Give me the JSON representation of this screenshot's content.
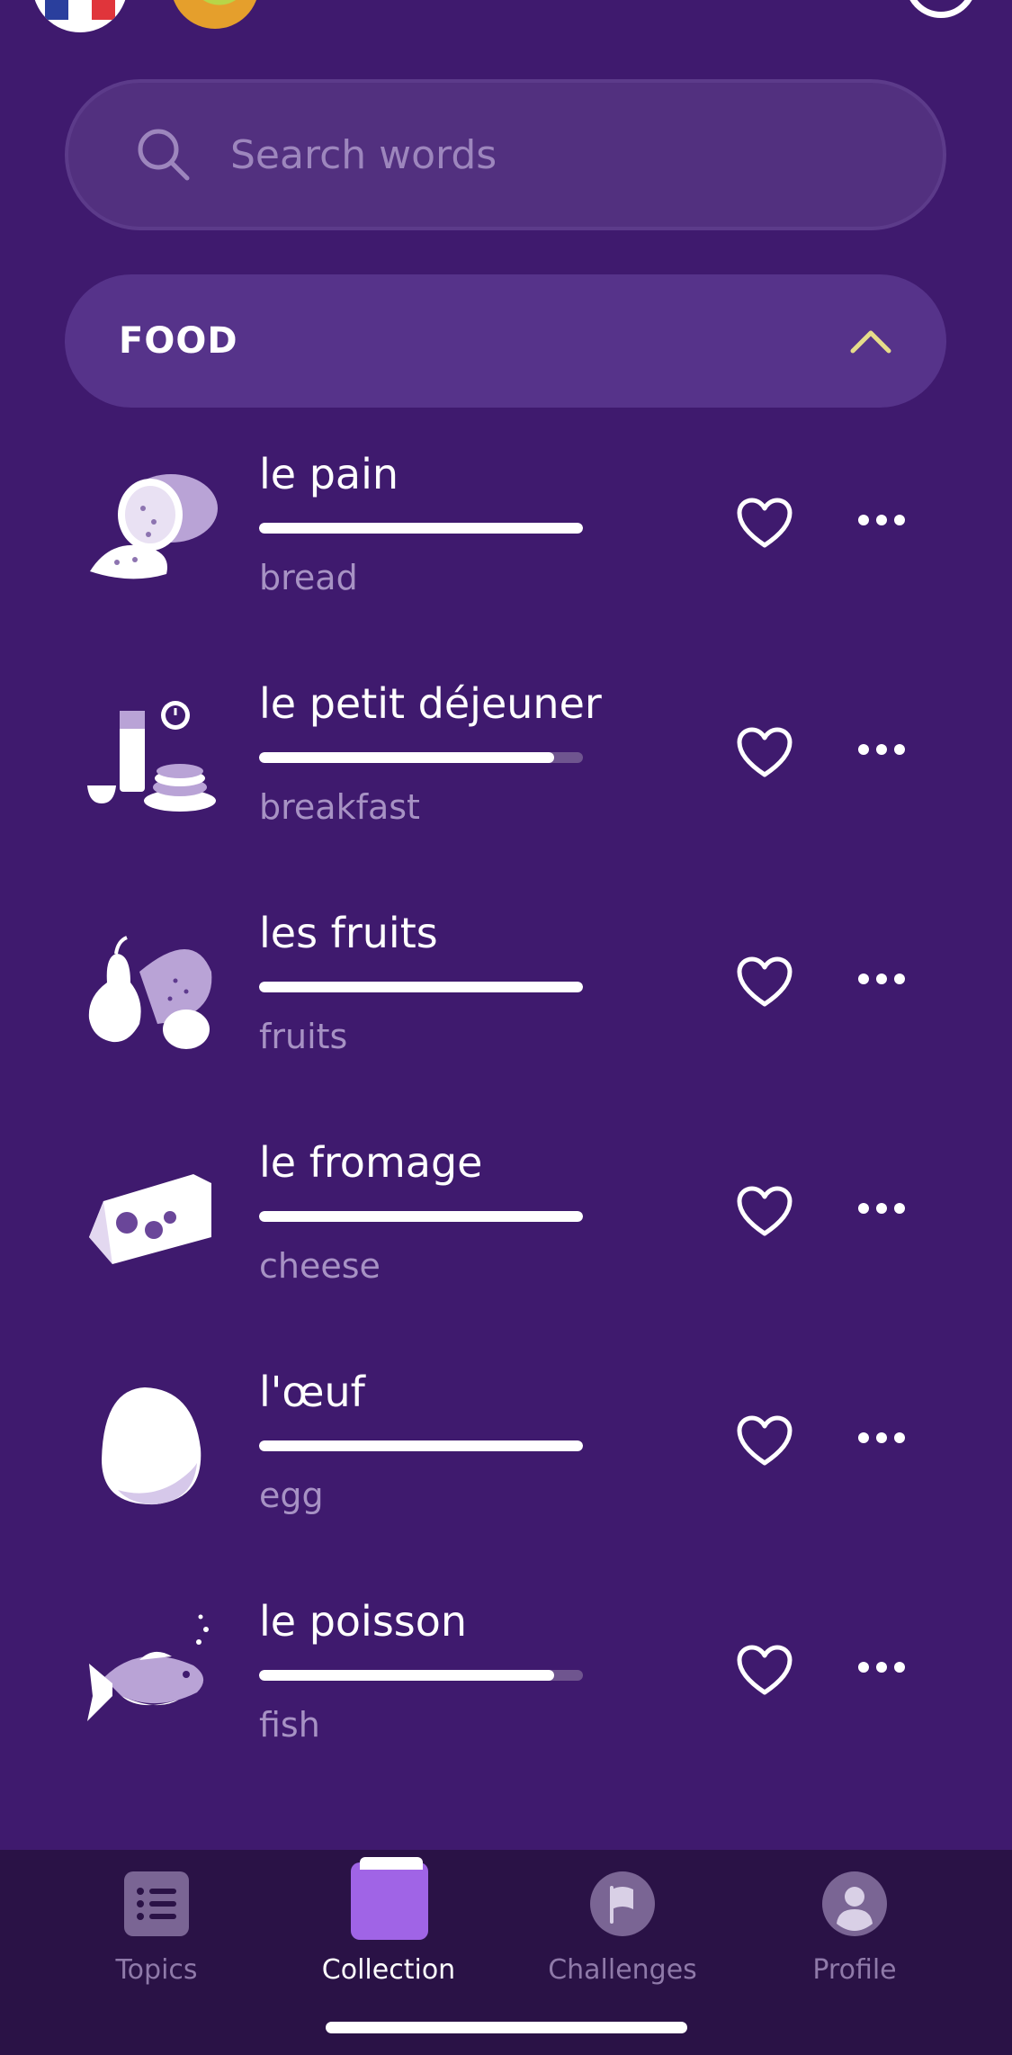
{
  "search": {
    "placeholder": "Search words"
  },
  "section": {
    "title": "FOOD",
    "chevron": "chevron-up-icon",
    "chevron_color": "#e6dc8a"
  },
  "items": [
    {
      "word": "le pain",
      "translation": "bread",
      "progress": 1.0,
      "icon": "bread-icon"
    },
    {
      "word": "le petit déjeuner",
      "translation": "breakfast",
      "progress": 0.91,
      "icon": "breakfast-icon"
    },
    {
      "word": "les fruits",
      "translation": "fruits",
      "progress": 1.0,
      "icon": "fruits-icon"
    },
    {
      "word": "le fromage",
      "translation": "cheese",
      "progress": 1.0,
      "icon": "cheese-icon"
    },
    {
      "word": "l'œuf",
      "translation": "egg",
      "progress": 1.0,
      "icon": "egg-icon"
    },
    {
      "word": "le poisson",
      "translation": "fish",
      "progress": 0.91,
      "icon": "fish-icon"
    }
  ],
  "nav": {
    "tabs": [
      {
        "label": "Topics",
        "icon": "list-icon"
      },
      {
        "label": "Collection",
        "icon": "book-icon",
        "active": true
      },
      {
        "label": "Challenges",
        "icon": "flag-icon"
      },
      {
        "label": "Profile",
        "icon": "person-icon"
      }
    ]
  },
  "colors": {
    "background": "#3f1a6e",
    "accent": "#a064e6",
    "nav_background": "#2a1246"
  }
}
